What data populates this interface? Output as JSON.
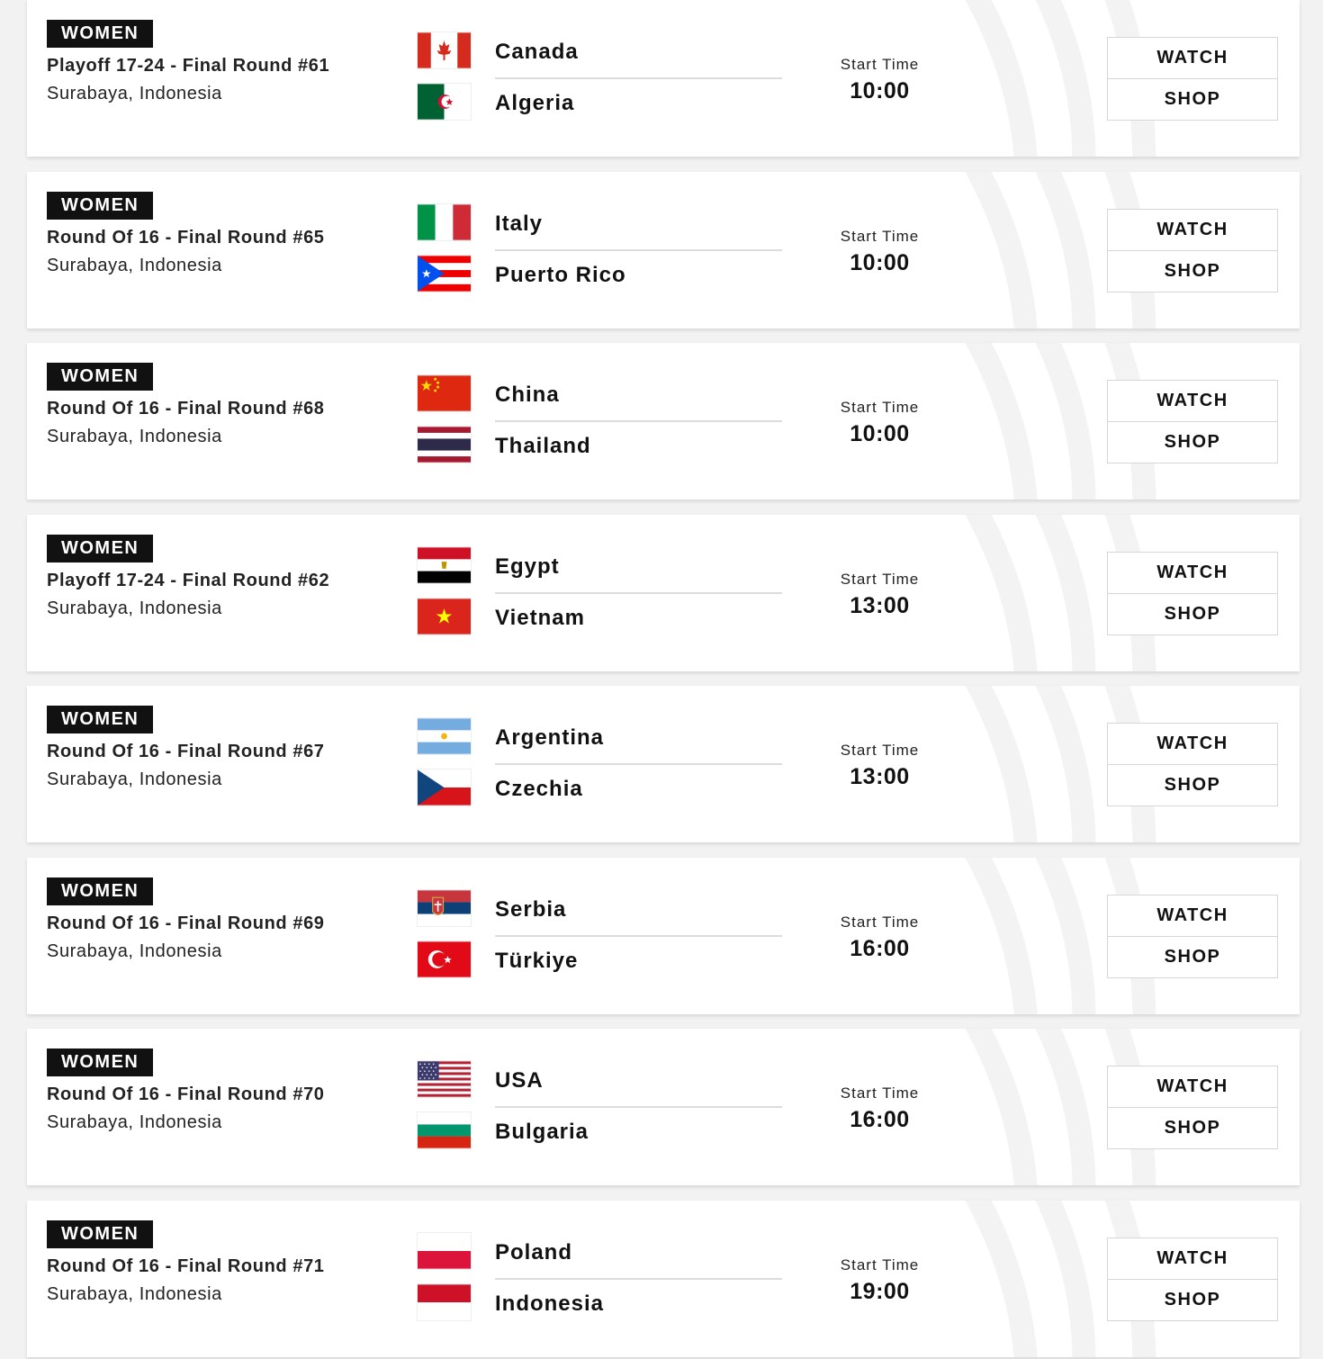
{
  "matches": [
    {
      "category": "WOMEN",
      "round": "Playoff 17-24 - Final Round #61",
      "location": "Surabaya, Indonesia",
      "home": {
        "name": "Canada",
        "flag": "canada-flag"
      },
      "away": {
        "name": "Algeria",
        "flag": "algeria-flag"
      },
      "start_label": "Start Time",
      "start_time": "10:00",
      "watch_label": "WATCH",
      "shop_label": "SHOP"
    },
    {
      "category": "WOMEN",
      "round": "Round Of 16 - Final Round #65",
      "location": "Surabaya, Indonesia",
      "home": {
        "name": "Italy",
        "flag": "italy-flag"
      },
      "away": {
        "name": "Puerto Rico",
        "flag": "puerto-rico-flag"
      },
      "start_label": "Start Time",
      "start_time": "10:00",
      "watch_label": "WATCH",
      "shop_label": "SHOP"
    },
    {
      "category": "WOMEN",
      "round": "Round Of 16 - Final Round #68",
      "location": "Surabaya, Indonesia",
      "home": {
        "name": "China",
        "flag": "china-flag"
      },
      "away": {
        "name": "Thailand",
        "flag": "thailand-flag"
      },
      "start_label": "Start Time",
      "start_time": "10:00",
      "watch_label": "WATCH",
      "shop_label": "SHOP"
    },
    {
      "category": "WOMEN",
      "round": "Playoff 17-24 - Final Round #62",
      "location": "Surabaya, Indonesia",
      "home": {
        "name": "Egypt",
        "flag": "egypt-flag"
      },
      "away": {
        "name": "Vietnam",
        "flag": "vietnam-flag"
      },
      "start_label": "Start Time",
      "start_time": "13:00",
      "watch_label": "WATCH",
      "shop_label": "SHOP"
    },
    {
      "category": "WOMEN",
      "round": "Round Of 16 - Final Round #67",
      "location": "Surabaya, Indonesia",
      "home": {
        "name": "Argentina",
        "flag": "argentina-flag"
      },
      "away": {
        "name": "Czechia",
        "flag": "czechia-flag"
      },
      "start_label": "Start Time",
      "start_time": "13:00",
      "watch_label": "WATCH",
      "shop_label": "SHOP"
    },
    {
      "category": "WOMEN",
      "round": "Round Of 16 - Final Round #69",
      "location": "Surabaya, Indonesia",
      "home": {
        "name": "Serbia",
        "flag": "serbia-flag"
      },
      "away": {
        "name": "Türkiye",
        "flag": "turkiye-flag"
      },
      "start_label": "Start Time",
      "start_time": "16:00",
      "watch_label": "WATCH",
      "shop_label": "SHOP"
    },
    {
      "category": "WOMEN",
      "round": "Round Of 16 - Final Round #70",
      "location": "Surabaya, Indonesia",
      "home": {
        "name": "USA",
        "flag": "usa-flag"
      },
      "away": {
        "name": "Bulgaria",
        "flag": "bulgaria-flag"
      },
      "start_label": "Start Time",
      "start_time": "16:00",
      "watch_label": "WATCH",
      "shop_label": "SHOP"
    },
    {
      "category": "WOMEN",
      "round": "Round Of 16 - Final Round #71",
      "location": "Surabaya, Indonesia",
      "home": {
        "name": "Poland",
        "flag": "poland-flag"
      },
      "away": {
        "name": "Indonesia",
        "flag": "indonesia-flag"
      },
      "start_label": "Start Time",
      "start_time": "19:00",
      "watch_label": "WATCH",
      "shop_label": "SHOP"
    }
  ]
}
